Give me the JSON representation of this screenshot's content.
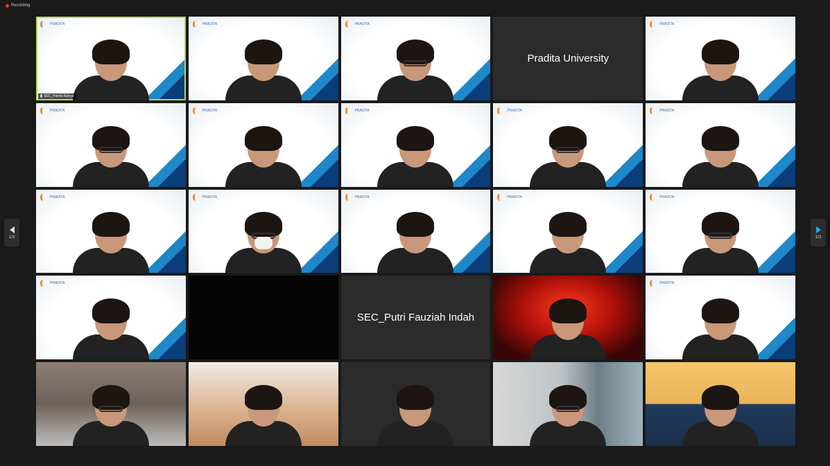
{
  "recording": {
    "label": "Recording"
  },
  "pager": {
    "left_label": "1/3",
    "right_label": "1/3"
  },
  "tiles": [
    {
      "kind": "video",
      "bg": "white",
      "active": true,
      "nametag": "SEC_Pandu Rahyu"
    },
    {
      "kind": "video",
      "bg": "white"
    },
    {
      "kind": "video",
      "bg": "white"
    },
    {
      "kind": "name",
      "name": "Pradita University"
    },
    {
      "kind": "video",
      "bg": "white"
    },
    {
      "kind": "video",
      "bg": "white"
    },
    {
      "kind": "video",
      "bg": "white"
    },
    {
      "kind": "video",
      "bg": "white"
    },
    {
      "kind": "video",
      "bg": "white"
    },
    {
      "kind": "video",
      "bg": "white"
    },
    {
      "kind": "video",
      "bg": "white"
    },
    {
      "kind": "video",
      "bg": "white"
    },
    {
      "kind": "video",
      "bg": "white"
    },
    {
      "kind": "video",
      "bg": "white"
    },
    {
      "kind": "video",
      "bg": "white"
    },
    {
      "kind": "video",
      "bg": "white"
    },
    {
      "kind": "video",
      "bg": "black"
    },
    {
      "kind": "name",
      "name": "SEC_Putri Fauziah Indah"
    },
    {
      "kind": "video",
      "bg": "red"
    },
    {
      "kind": "video",
      "bg": "white"
    },
    {
      "kind": "video",
      "bg": "room"
    },
    {
      "kind": "video",
      "bg": "couch"
    },
    {
      "kind": "video",
      "bg": "dark"
    },
    {
      "kind": "video",
      "bg": "hall"
    },
    {
      "kind": "video",
      "bg": "poster"
    }
  ],
  "logo": {
    "brand": "PRADITA",
    "sub": "University"
  }
}
